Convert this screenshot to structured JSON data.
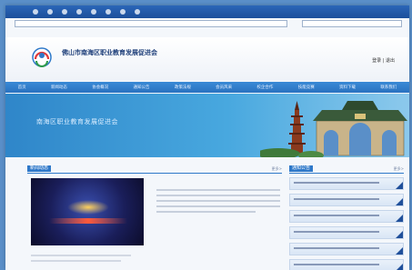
{
  "browser": {
    "address": "",
    "search": ""
  },
  "site": {
    "title": "佛山市南海区职业教育发展促进会",
    "subtitle": "",
    "header_links": "登录 | 退出"
  },
  "nav": {
    "items": [
      "首页",
      "新闻动态",
      "协会概况",
      "通知公告",
      "政策法规",
      "会员风采",
      "校企合作",
      "技能竞赛",
      "资料下载",
      "联系我们"
    ]
  },
  "banner": {
    "text": "南海区职业教育发展促进会"
  },
  "news": {
    "section_title": "新闻动态",
    "more": "更多>",
    "headline": ""
  },
  "notice": {
    "section_title": "通知公告",
    "more": "更多>",
    "count": 6
  },
  "colors": {
    "nav": "#2a72c0",
    "accent": "#2e78c9",
    "corner": "#1f4f9a"
  }
}
